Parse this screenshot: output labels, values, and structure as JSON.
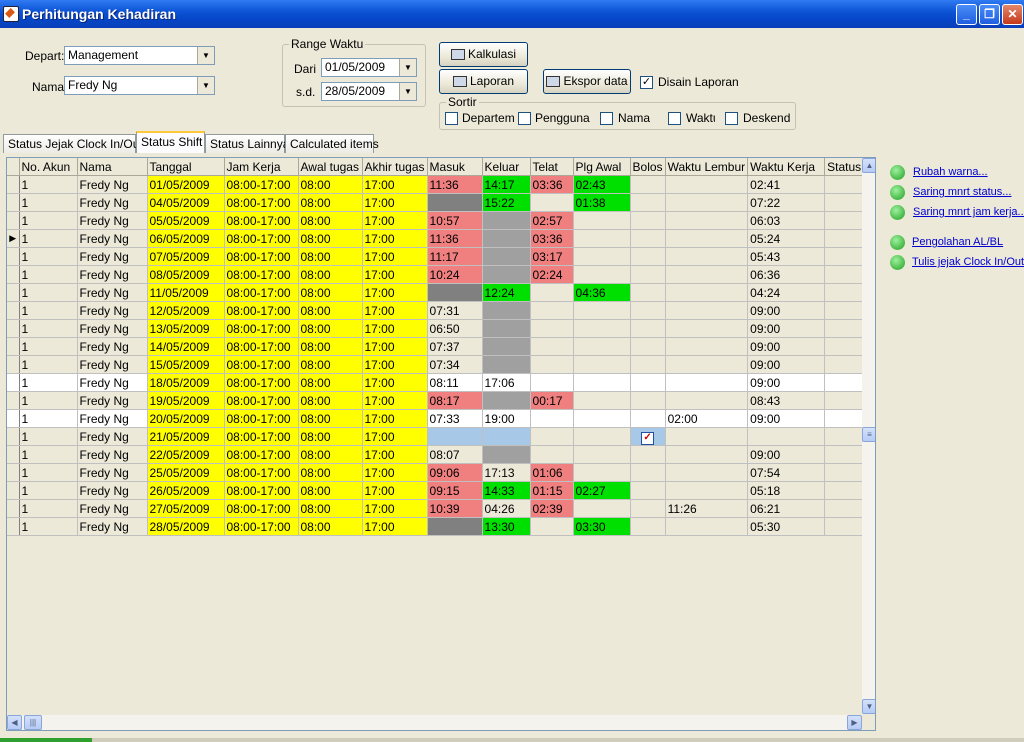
{
  "window": {
    "title": "Perhitungan Kehadiran"
  },
  "filters": {
    "depart_label": "Depart:",
    "depart_value": "Management",
    "nama_label": "Nama:",
    "nama_value": "Fredy Ng"
  },
  "range": {
    "title": "Range Waktu",
    "from_label": "Dari",
    "from_value": "01/05/2009",
    "to_label": "s.d.",
    "to_value": "28/05/2009"
  },
  "actions": {
    "kalkulasi": "Kalkulasi",
    "laporan": "Laporan",
    "ekspor": "Ekspor data",
    "disain_label": "Disain Laporan",
    "disain_checked": true
  },
  "sortir": {
    "title": "Sortir",
    "options": [
      "Departeme",
      "Pengguna",
      "Nama",
      "Waktu",
      "Deskend"
    ]
  },
  "tabs": [
    "Status Jejak Clock In/Out",
    "Status Shift",
    "Status Lainnya",
    "Calculated items"
  ],
  "active_tab": "Status Shift",
  "grid": {
    "columns": [
      "No. Akun",
      "Nama",
      "Tanggal",
      "Jam Kerja",
      "Awal tugas",
      "Akhir tugas",
      "Masuk",
      "Keluar",
      "Telat",
      "Plg Awal",
      "Bolos",
      "Waktu Lembur",
      "Waktu Kerja",
      "Status"
    ],
    "current_row": 3,
    "rows": [
      {
        "akun": "1",
        "nama": "Fredy Ng",
        "tanggal": "01/05/2009",
        "jam": "08:00-17:00",
        "awal": "08:00",
        "akhir": "17:00",
        "masuk": "11:36",
        "keluar": "14:17",
        "telat": "03:36",
        "plg": "02:43",
        "bolos": "",
        "lembur": "",
        "kerja": "02:41",
        "status": "",
        "bg": "",
        "c_masuk": "r",
        "c_keluar": "g",
        "c_telat": "r",
        "c_plg": "g",
        "c_bolos": ""
      },
      {
        "akun": "1",
        "nama": "Fredy Ng",
        "tanggal": "04/05/2009",
        "jam": "08:00-17:00",
        "awal": "08:00",
        "akhir": "17:00",
        "masuk": "",
        "keluar": "15:22",
        "telat": "",
        "plg": "01:38",
        "bolos": "",
        "lembur": "",
        "kerja": "07:22",
        "status": "",
        "bg": "",
        "c_masuk": "dg",
        "c_keluar": "g",
        "c_telat": "",
        "c_plg": "g",
        "c_bolos": ""
      },
      {
        "akun": "1",
        "nama": "Fredy Ng",
        "tanggal": "05/05/2009",
        "jam": "08:00-17:00",
        "awal": "08:00",
        "akhir": "17:00",
        "masuk": "10:57",
        "keluar": "",
        "telat": "02:57",
        "plg": "",
        "bolos": "",
        "lembur": "",
        "kerja": "06:03",
        "status": "",
        "bg": "",
        "c_masuk": "r",
        "c_keluar": "mg",
        "c_telat": "r",
        "c_plg": "",
        "c_bolos": ""
      },
      {
        "akun": "1",
        "nama": "Fredy Ng",
        "tanggal": "06/05/2009",
        "jam": "08:00-17:00",
        "awal": "08:00",
        "akhir": "17:00",
        "masuk": "11:36",
        "keluar": "",
        "telat": "03:36",
        "plg": "",
        "bolos": "",
        "lembur": "",
        "kerja": "05:24",
        "status": "",
        "bg": "",
        "c_masuk": "r",
        "c_keluar": "mg",
        "c_telat": "r",
        "c_plg": "",
        "c_bolos": ""
      },
      {
        "akun": "1",
        "nama": "Fredy Ng",
        "tanggal": "07/05/2009",
        "jam": "08:00-17:00",
        "awal": "08:00",
        "akhir": "17:00",
        "masuk": "11:17",
        "keluar": "",
        "telat": "03:17",
        "plg": "",
        "bolos": "",
        "lembur": "",
        "kerja": "05:43",
        "status": "",
        "bg": "",
        "c_masuk": "r",
        "c_keluar": "mg",
        "c_telat": "r",
        "c_plg": "",
        "c_bolos": ""
      },
      {
        "akun": "1",
        "nama": "Fredy Ng",
        "tanggal": "08/05/2009",
        "jam": "08:00-17:00",
        "awal": "08:00",
        "akhir": "17:00",
        "masuk": "10:24",
        "keluar": "",
        "telat": "02:24",
        "plg": "",
        "bolos": "",
        "lembur": "",
        "kerja": "06:36",
        "status": "",
        "bg": "",
        "c_masuk": "r",
        "c_keluar": "mg",
        "c_telat": "r",
        "c_plg": "",
        "c_bolos": ""
      },
      {
        "akun": "1",
        "nama": "Fredy Ng",
        "tanggal": "11/05/2009",
        "jam": "08:00-17:00",
        "awal": "08:00",
        "akhir": "17:00",
        "masuk": "",
        "keluar": "12:24",
        "telat": "",
        "plg": "04:36",
        "bolos": "",
        "lembur": "",
        "kerja": "04:24",
        "status": "",
        "bg": "",
        "c_masuk": "dg",
        "c_keluar": "g",
        "c_telat": "",
        "c_plg": "g",
        "c_bolos": ""
      },
      {
        "akun": "1",
        "nama": "Fredy Ng",
        "tanggal": "12/05/2009",
        "jam": "08:00-17:00",
        "awal": "08:00",
        "akhir": "17:00",
        "masuk": "07:31",
        "keluar": "",
        "telat": "",
        "plg": "",
        "bolos": "",
        "lembur": "",
        "kerja": "09:00",
        "status": "",
        "bg": "",
        "c_masuk": "",
        "c_keluar": "mg",
        "c_telat": "",
        "c_plg": "",
        "c_bolos": ""
      },
      {
        "akun": "1",
        "nama": "Fredy Ng",
        "tanggal": "13/05/2009",
        "jam": "08:00-17:00",
        "awal": "08:00",
        "akhir": "17:00",
        "masuk": "06:50",
        "keluar": "",
        "telat": "",
        "plg": "",
        "bolos": "",
        "lembur": "",
        "kerja": "09:00",
        "status": "",
        "bg": "",
        "c_masuk": "",
        "c_keluar": "mg",
        "c_telat": "",
        "c_plg": "",
        "c_bolos": ""
      },
      {
        "akun": "1",
        "nama": "Fredy Ng",
        "tanggal": "14/05/2009",
        "jam": "08:00-17:00",
        "awal": "08:00",
        "akhir": "17:00",
        "masuk": "07:37",
        "keluar": "",
        "telat": "",
        "plg": "",
        "bolos": "",
        "lembur": "",
        "kerja": "09:00",
        "status": "",
        "bg": "",
        "c_masuk": "",
        "c_keluar": "mg",
        "c_telat": "",
        "c_plg": "",
        "c_bolos": ""
      },
      {
        "akun": "1",
        "nama": "Fredy Ng",
        "tanggal": "15/05/2009",
        "jam": "08:00-17:00",
        "awal": "08:00",
        "akhir": "17:00",
        "masuk": "07:34",
        "keluar": "",
        "telat": "",
        "plg": "",
        "bolos": "",
        "lembur": "",
        "kerja": "09:00",
        "status": "",
        "bg": "",
        "c_masuk": "",
        "c_keluar": "mg",
        "c_telat": "",
        "c_plg": "",
        "c_bolos": ""
      },
      {
        "akun": "1",
        "nama": "Fredy Ng",
        "tanggal": "18/05/2009",
        "jam": "08:00-17:00",
        "awal": "08:00",
        "akhir": "17:00",
        "masuk": "08:11",
        "keluar": "17:06",
        "telat": "",
        "plg": "",
        "bolos": "",
        "lembur": "",
        "kerja": "09:00",
        "status": "",
        "bg": "white",
        "c_masuk": "",
        "c_keluar": "",
        "c_telat": "",
        "c_plg": "",
        "c_bolos": ""
      },
      {
        "akun": "1",
        "nama": "Fredy Ng",
        "tanggal": "19/05/2009",
        "jam": "08:00-17:00",
        "awal": "08:00",
        "akhir": "17:00",
        "masuk": "08:17",
        "keluar": "",
        "telat": "00:17",
        "plg": "",
        "bolos": "",
        "lembur": "",
        "kerja": "08:43",
        "status": "",
        "bg": "",
        "c_masuk": "r",
        "c_keluar": "mg",
        "c_telat": "r",
        "c_plg": "",
        "c_bolos": ""
      },
      {
        "akun": "1",
        "nama": "Fredy Ng",
        "tanggal": "20/05/2009",
        "jam": "08:00-17:00",
        "awal": "08:00",
        "akhir": "17:00",
        "masuk": "07:33",
        "keluar": "19:00",
        "telat": "",
        "plg": "",
        "bolos": "",
        "lembur": "02:00",
        "kerja": "09:00",
        "status": "",
        "bg": "white",
        "c_masuk": "",
        "c_keluar": "",
        "c_telat": "",
        "c_plg": "",
        "c_bolos": ""
      },
      {
        "akun": "1",
        "nama": "Fredy Ng",
        "tanggal": "21/05/2009",
        "jam": "08:00-17:00",
        "awal": "08:00",
        "akhir": "17:00",
        "masuk": "",
        "keluar": "",
        "telat": "",
        "plg": "",
        "bolos": "✓",
        "lembur": "",
        "kerja": "",
        "status": "",
        "bg": "",
        "c_masuk": "b",
        "c_keluar": "b",
        "c_telat": "",
        "c_plg": "",
        "c_bolos": "b"
      },
      {
        "akun": "1",
        "nama": "Fredy Ng",
        "tanggal": "22/05/2009",
        "jam": "08:00-17:00",
        "awal": "08:00",
        "akhir": "17:00",
        "masuk": "08:07",
        "keluar": "",
        "telat": "",
        "plg": "",
        "bolos": "",
        "lembur": "",
        "kerja": "09:00",
        "status": "",
        "bg": "",
        "c_masuk": "",
        "c_keluar": "mg",
        "c_telat": "",
        "c_plg": "",
        "c_bolos": ""
      },
      {
        "akun": "1",
        "nama": "Fredy Ng",
        "tanggal": "25/05/2009",
        "jam": "08:00-17:00",
        "awal": "08:00",
        "akhir": "17:00",
        "masuk": "09:06",
        "keluar": "17:13",
        "telat": "01:06",
        "plg": "",
        "bolos": "",
        "lembur": "",
        "kerja": "07:54",
        "status": "",
        "bg": "",
        "c_masuk": "r",
        "c_keluar": "",
        "c_telat": "r",
        "c_plg": "",
        "c_bolos": ""
      },
      {
        "akun": "1",
        "nama": "Fredy Ng",
        "tanggal": "26/05/2009",
        "jam": "08:00-17:00",
        "awal": "08:00",
        "akhir": "17:00",
        "masuk": "09:15",
        "keluar": "14:33",
        "telat": "01:15",
        "plg": "02:27",
        "bolos": "",
        "lembur": "",
        "kerja": "05:18",
        "status": "",
        "bg": "",
        "c_masuk": "r",
        "c_keluar": "g",
        "c_telat": "r",
        "c_plg": "g",
        "c_bolos": ""
      },
      {
        "akun": "1",
        "nama": "Fredy Ng",
        "tanggal": "27/05/2009",
        "jam": "08:00-17:00",
        "awal": "08:00",
        "akhir": "17:00",
        "masuk": "10:39",
        "keluar": "04:26",
        "telat": "02:39",
        "plg": "",
        "bolos": "",
        "lembur": "11:26",
        "kerja": "06:21",
        "status": "",
        "bg": "",
        "c_masuk": "r",
        "c_keluar": "",
        "c_telat": "r",
        "c_plg": "",
        "c_bolos": ""
      },
      {
        "akun": "1",
        "nama": "Fredy Ng",
        "tanggal": "28/05/2009",
        "jam": "08:00-17:00",
        "awal": "08:00",
        "akhir": "17:00",
        "masuk": "",
        "keluar": "13:30",
        "telat": "",
        "plg": "03:30",
        "bolos": "",
        "lembur": "",
        "kerja": "05:30",
        "status": "",
        "bg": "",
        "c_masuk": "dg",
        "c_keluar": "g",
        "c_telat": "",
        "c_plg": "g",
        "c_bolos": ""
      }
    ]
  },
  "side_links": [
    "Rubah warna...",
    "Saring mnrt status...",
    "Saring mnrt jam kerja...",
    "Pengolahan AL/BL",
    "Tulis jejak Clock In/Out"
  ],
  "colors": {
    "highlight_yellow": "#ffff00",
    "late_red": "#f08080",
    "early_green": "#00e000",
    "missing_gray": "#808080",
    "title_blue": "#0a54d6"
  }
}
